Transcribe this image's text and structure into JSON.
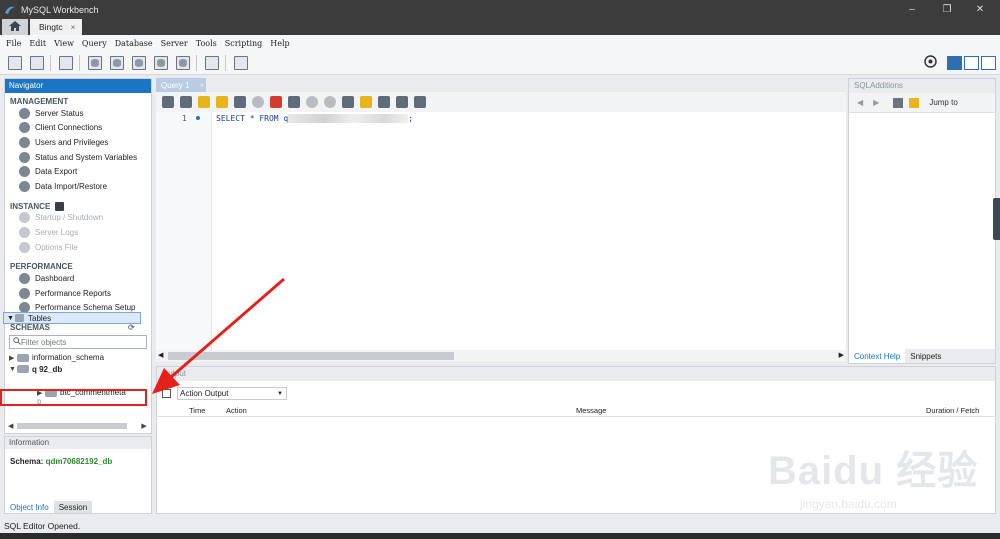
{
  "window": {
    "title": "MySQL Workbench"
  },
  "tabs": {
    "connection": "Bingtc",
    "close": "×"
  },
  "menu": [
    "File",
    "Edit",
    "View",
    "Query",
    "Database",
    "Server",
    "Tools",
    "Scripting",
    "Help"
  ],
  "navigator": {
    "header": "Navigator",
    "management": {
      "title": "MANAGEMENT",
      "items": [
        "Server Status",
        "Client Connections",
        "Users and Privileges",
        "Status and System Variables",
        "Data Export",
        "Data Import/Restore"
      ]
    },
    "instance": {
      "title": "INSTANCE",
      "items": [
        "Startup / Shutdown",
        "Server Logs",
        "Options File"
      ]
    },
    "performance": {
      "title": "PERFORMANCE",
      "items": [
        "Dashboard",
        "Performance Reports",
        "Performance Schema Setup"
      ]
    },
    "schemas": {
      "title": "SCHEMAS",
      "filter_placeholder": "Filter objects",
      "tree": [
        "information_schema",
        "q        92_db",
        "Tables",
        "btc_commentmeta",
        "b"
      ]
    }
  },
  "info": {
    "header": "Information",
    "schema_label": "Schema:",
    "schema_value": "qdm70682192_db",
    "tab_object": "Object Info",
    "tab_session": "Session"
  },
  "query": {
    "tab": "Query 1",
    "line_number": "1",
    "sql_prefix": "SELECT * FROM q",
    "sql_suffix": ";"
  },
  "sql_additions": {
    "header": "SQLAdditions",
    "jump_to": "Jump to",
    "tab_context": "Context Help",
    "tab_snippets": "Snippets"
  },
  "output": {
    "header": "Output",
    "selector": "Action Output",
    "columns": [
      "Time",
      "Action",
      "Message",
      "Duration / Fetch"
    ]
  },
  "status": {
    "text": "SQL Editor Opened."
  },
  "watermark": {
    "brand": "Baidu 经验",
    "sub": "jingyan.baidu.com"
  },
  "colors": {
    "accent": "#1c75c4",
    "highlight": "#e5211b",
    "schema": "#2d8a2d"
  }
}
